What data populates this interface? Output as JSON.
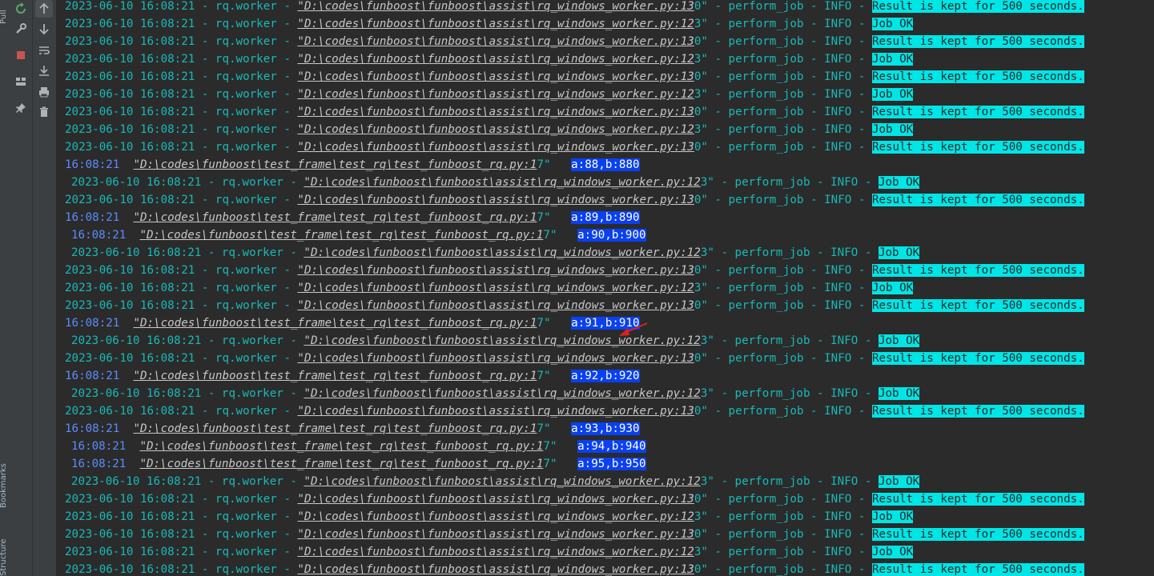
{
  "sidebar": {
    "tabs": [
      {
        "label": "Pull"
      },
      {
        "label": "Bookmarks"
      },
      {
        "label": "Structure"
      }
    ]
  },
  "toolbar_primary": [
    {
      "icon": "rerun-icon"
    },
    {
      "icon": "wrench-icon"
    },
    {
      "icon": "stop-icon"
    },
    {
      "icon": "layout-icon"
    },
    {
      "icon": "pin-icon"
    }
  ],
  "toolbar_secondary": [
    {
      "icon": "scroll-up-icon"
    },
    {
      "icon": "scroll-down-icon"
    },
    {
      "icon": "soft-wrap-icon"
    },
    {
      "icon": "scroll-to-end-icon"
    },
    {
      "icon": "print-icon"
    },
    {
      "icon": "trash-icon"
    }
  ],
  "colors": {
    "console_bg": "#2b2b2b",
    "log_text": "#19b9b8",
    "path_text": "#c7c7c7",
    "highlight_cyan": "#00e5e6",
    "print_timestamp": "#5c8cff",
    "highlight_blue": "#0a40f0",
    "annotation_arrow": "#e02020"
  },
  "log_lines": [
    {
      "type": "worker",
      "prefix": "2023-06-10 16:08:21 - rq.worker - ",
      "path": "\"D:\\codes\\funboost\\funboost\\assist\\rq_windows_worker.py:13",
      "path_tail": "0\"",
      "mid": " - perform_job - INFO - ",
      "msg": "Result is kept for 500 seconds.",
      "indent": false
    },
    {
      "type": "worker",
      "prefix": "2023-06-10 16:08:21 - rq.worker - ",
      "path": "\"D:\\codes\\funboost\\funboost\\assist\\rq_windows_worker.py:12",
      "path_tail": "3\"",
      "mid": " - perform_job - INFO - ",
      "msg": "Job OK",
      "indent": false
    },
    {
      "type": "worker",
      "prefix": "2023-06-10 16:08:21 - rq.worker - ",
      "path": "\"D:\\codes\\funboost\\funboost\\assist\\rq_windows_worker.py:13",
      "path_tail": "0\"",
      "mid": " - perform_job - INFO - ",
      "msg": "Result is kept for 500 seconds.",
      "indent": false
    },
    {
      "type": "worker",
      "prefix": "2023-06-10 16:08:21 - rq.worker - ",
      "path": "\"D:\\codes\\funboost\\funboost\\assist\\rq_windows_worker.py:12",
      "path_tail": "3\"",
      "mid": " - perform_job - INFO - ",
      "msg": "Job OK",
      "indent": false
    },
    {
      "type": "worker",
      "prefix": "2023-06-10 16:08:21 - rq.worker - ",
      "path": "\"D:\\codes\\funboost\\funboost\\assist\\rq_windows_worker.py:13",
      "path_tail": "0\"",
      "mid": " - perform_job - INFO - ",
      "msg": "Result is kept for 500 seconds.",
      "indent": false
    },
    {
      "type": "worker",
      "prefix": "2023-06-10 16:08:21 - rq.worker - ",
      "path": "\"D:\\codes\\funboost\\funboost\\assist\\rq_windows_worker.py:12",
      "path_tail": "3\"",
      "mid": " - perform_job - INFO - ",
      "msg": "Job OK",
      "indent": false
    },
    {
      "type": "worker",
      "prefix": "2023-06-10 16:08:21 - rq.worker - ",
      "path": "\"D:\\codes\\funboost\\funboost\\assist\\rq_windows_worker.py:13",
      "path_tail": "0\"",
      "mid": " - perform_job - INFO - ",
      "msg": "Result is kept for 500 seconds.",
      "indent": false
    },
    {
      "type": "worker",
      "prefix": "2023-06-10 16:08:21 - rq.worker - ",
      "path": "\"D:\\codes\\funboost\\funboost\\assist\\rq_windows_worker.py:12",
      "path_tail": "3\"",
      "mid": " - perform_job - INFO - ",
      "msg": "Job OK",
      "indent": false
    },
    {
      "type": "worker",
      "prefix": "2023-06-10 16:08:21 - rq.worker - ",
      "path": "\"D:\\codes\\funboost\\funboost\\assist\\rq_windows_worker.py:13",
      "path_tail": "0\"",
      "mid": " - perform_job - INFO - ",
      "msg": "Result is kept for 500 seconds.",
      "indent": false
    },
    {
      "type": "print",
      "time": "16:08:21",
      "path": "\"D:\\codes\\funboost\\test_frame\\test_rq\\test_funboost_rq.py:1",
      "path_tail": "7\"",
      "msg": "a:88,b:880",
      "indent": false
    },
    {
      "type": "worker",
      "prefix": "2023-06-10 16:08:21 - rq.worker - ",
      "path": "\"D:\\codes\\funboost\\funboost\\assist\\rq_windows_worker.py:12",
      "path_tail": "3\"",
      "mid": " - perform_job - INFO - ",
      "msg": "Job OK",
      "indent": true
    },
    {
      "type": "worker",
      "prefix": "2023-06-10 16:08:21 - rq.worker - ",
      "path": "\"D:\\codes\\funboost\\funboost\\assist\\rq_windows_worker.py:13",
      "path_tail": "0\"",
      "mid": " - perform_job - INFO - ",
      "msg": "Result is kept for 500 seconds.",
      "indent": false
    },
    {
      "type": "print",
      "time": "16:08:21",
      "path": "\"D:\\codes\\funboost\\test_frame\\test_rq\\test_funboost_rq.py:1",
      "path_tail": "7\"",
      "msg": "a:89,b:890",
      "indent": false
    },
    {
      "type": "print",
      "time": "16:08:21",
      "path": "\"D:\\codes\\funboost\\test_frame\\test_rq\\test_funboost_rq.py:1",
      "path_tail": "7\"",
      "msg": "a:90,b:900",
      "indent": true
    },
    {
      "type": "worker",
      "prefix": "2023-06-10 16:08:21 - rq.worker - ",
      "path": "\"D:\\codes\\funboost\\funboost\\assist\\rq_windows_worker.py:12",
      "path_tail": "3\"",
      "mid": " - perform_job - INFO - ",
      "msg": "Job OK",
      "indent": true
    },
    {
      "type": "worker",
      "prefix": "2023-06-10 16:08:21 - rq.worker - ",
      "path": "\"D:\\codes\\funboost\\funboost\\assist\\rq_windows_worker.py:13",
      "path_tail": "0\"",
      "mid": " - perform_job - INFO - ",
      "msg": "Result is kept for 500 seconds.",
      "indent": false
    },
    {
      "type": "worker",
      "prefix": "2023-06-10 16:08:21 - rq.worker - ",
      "path": "\"D:\\codes\\funboost\\funboost\\assist\\rq_windows_worker.py:12",
      "path_tail": "3\"",
      "mid": " - perform_job - INFO - ",
      "msg": "Job OK",
      "indent": false
    },
    {
      "type": "worker",
      "prefix": "2023-06-10 16:08:21 - rq.worker - ",
      "path": "\"D:\\codes\\funboost\\funboost\\assist\\rq_windows_worker.py:13",
      "path_tail": "0\"",
      "mid": " - perform_job - INFO - ",
      "msg": "Result is kept for 500 seconds.",
      "indent": false
    },
    {
      "type": "print",
      "time": "16:08:21",
      "path": "\"D:\\codes\\funboost\\test_frame\\test_rq\\test_funboost_rq.py:1",
      "path_tail": "7\"",
      "msg": "a:91,b:910",
      "indent": false
    },
    {
      "type": "worker",
      "prefix": "2023-06-10 16:08:21 - rq.worker - ",
      "path": "\"D:\\codes\\funboost\\funboost\\assist\\rq_windows_worker.py:12",
      "path_tail": "3\"",
      "mid": " - perform_job - INFO - ",
      "msg": "Job OK",
      "indent": true
    },
    {
      "type": "worker",
      "prefix": "2023-06-10 16:08:21 - rq.worker - ",
      "path": "\"D:\\codes\\funboost\\funboost\\assist\\rq_windows_worker.py:13",
      "path_tail": "0\"",
      "mid": " - perform_job - INFO - ",
      "msg": "Result is kept for 500 seconds.",
      "indent": false
    },
    {
      "type": "print",
      "time": "16:08:21",
      "path": "\"D:\\codes\\funboost\\test_frame\\test_rq\\test_funboost_rq.py:1",
      "path_tail": "7\"",
      "msg": "a:92,b:920",
      "indent": false
    },
    {
      "type": "worker",
      "prefix": "2023-06-10 16:08:21 - rq.worker - ",
      "path": "\"D:\\codes\\funboost\\funboost\\assist\\rq_windows_worker.py:12",
      "path_tail": "3\"",
      "mid": " - perform_job - INFO - ",
      "msg": "Job OK",
      "indent": true
    },
    {
      "type": "worker",
      "prefix": "2023-06-10 16:08:21 - rq.worker - ",
      "path": "\"D:\\codes\\funboost\\funboost\\assist\\rq_windows_worker.py:13",
      "path_tail": "0\"",
      "mid": " - perform_job - INFO - ",
      "msg": "Result is kept for 500 seconds.",
      "indent": false
    },
    {
      "type": "print",
      "time": "16:08:21",
      "path": "\"D:\\codes\\funboost\\test_frame\\test_rq\\test_funboost_rq.py:1",
      "path_tail": "7\"",
      "msg": "a:93,b:930",
      "indent": false
    },
    {
      "type": "print",
      "time": "16:08:21",
      "path": "\"D:\\codes\\funboost\\test_frame\\test_rq\\test_funboost_rq.py:1",
      "path_tail": "7\"",
      "msg": "a:94,b:940",
      "indent": true
    },
    {
      "type": "print",
      "time": "16:08:21",
      "path": "\"D:\\codes\\funboost\\test_frame\\test_rq\\test_funboost_rq.py:1",
      "path_tail": "7\"",
      "msg": "a:95,b:950",
      "indent": true
    },
    {
      "type": "worker",
      "prefix": "2023-06-10 16:08:21 - rq.worker - ",
      "path": "\"D:\\codes\\funboost\\funboost\\assist\\rq_windows_worker.py:12",
      "path_tail": "3\"",
      "mid": " - perform_job - INFO - ",
      "msg": "Job OK",
      "indent": true
    },
    {
      "type": "worker",
      "prefix": "2023-06-10 16:08:21 - rq.worker - ",
      "path": "\"D:\\codes\\funboost\\funboost\\assist\\rq_windows_worker.py:13",
      "path_tail": "0\"",
      "mid": " - perform_job - INFO - ",
      "msg": "Result is kept for 500 seconds.",
      "indent": false
    },
    {
      "type": "worker",
      "prefix": "2023-06-10 16:08:21 - rq.worker - ",
      "path": "\"D:\\codes\\funboost\\funboost\\assist\\rq_windows_worker.py:12",
      "path_tail": "3\"",
      "mid": " - perform_job - INFO - ",
      "msg": "Job OK",
      "indent": false
    },
    {
      "type": "worker",
      "prefix": "2023-06-10 16:08:21 - rq.worker - ",
      "path": "\"D:\\codes\\funboost\\funboost\\assist\\rq_windows_worker.py:13",
      "path_tail": "0\"",
      "mid": " - perform_job - INFO - ",
      "msg": "Result is kept for 500 seconds.",
      "indent": false
    },
    {
      "type": "worker",
      "prefix": "2023-06-10 16:08:21 - rq.worker - ",
      "path": "\"D:\\codes\\funboost\\funboost\\assist\\rq_windows_worker.py:12",
      "path_tail": "3\"",
      "mid": " - perform_job - INFO - ",
      "msg": "Job OK",
      "indent": false
    },
    {
      "type": "worker",
      "prefix": "2023-06-10 16:08:21 - rq.worker - ",
      "path": "\"D:\\codes\\funboost\\funboost\\assist\\rq_windows_worker.py:13",
      "path_tail": "0\"",
      "mid": " - perform_job - INFO - ",
      "msg": "Result is kept for 500 seconds.",
      "indent": false
    }
  ]
}
